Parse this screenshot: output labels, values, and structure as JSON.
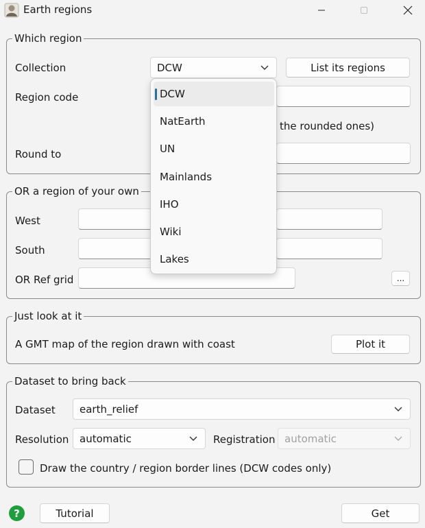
{
  "window": {
    "title": "Earth regions"
  },
  "which_region": {
    "group_title": "Which region",
    "collection_label": "Collection",
    "collection_value": "DCW",
    "list_regions_button": "List its regions",
    "region_code_label": "Region code",
    "round_note": "the rounded ones)",
    "round_to_label": "Round to"
  },
  "collection_dropdown": {
    "options": [
      "DCW",
      "NatEarth",
      "UN",
      "Mainlands",
      "IHO",
      "Wiki",
      "Lakes"
    ],
    "selected": "DCW"
  },
  "own_region": {
    "group_title": "OR a region of your own",
    "west_label": "West",
    "south_label": "South",
    "ref_grid_label": "OR Ref grid",
    "browse_button": "..."
  },
  "just_look": {
    "group_title": "Just look at it",
    "description": "A GMT map of the region drawn with coast",
    "plot_button": "Plot it"
  },
  "dataset": {
    "group_title": "Dataset to bring back",
    "dataset_label": "Dataset",
    "dataset_value": "earth_relief",
    "resolution_label": "Resolution",
    "resolution_value": "automatic",
    "registration_label": "Registration",
    "registration_value": "automatic",
    "border_checkbox_label": "Draw the country / region border lines (DCW codes only)",
    "border_checked": false
  },
  "footer": {
    "help_icon": "?",
    "tutorial_button": "Tutorial",
    "get_button": "Get"
  }
}
